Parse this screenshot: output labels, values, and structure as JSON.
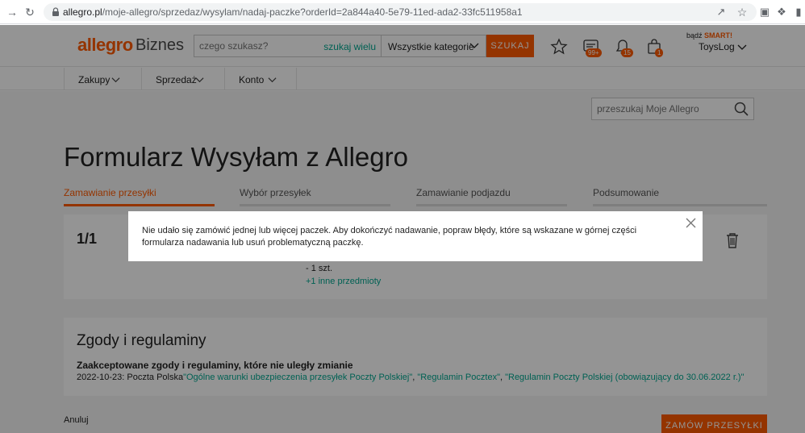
{
  "browser": {
    "url_host": "allegro.pl",
    "url_path": "/moje-allegro/sprzedaz/wysylam/nadaj-paczke?orderId=2a844a40-5e79-11ed-ada2-33fc511958a1"
  },
  "header": {
    "logo": "allegro",
    "logo_sub": "Biznes",
    "search_placeholder": "czego szukasz?",
    "search_many": "szukaj wielu",
    "category": "Wszystkie kategorie",
    "search_button": "SZUKAJ",
    "messages_badge": "99+",
    "notifications_badge": "15",
    "cart_badge": "1",
    "smart_prefix": "bądź",
    "smart_label": "SMART!",
    "user": "ToysLog"
  },
  "nav": {
    "items": [
      {
        "label": "Zakupy"
      },
      {
        "label": "Sprzedaż"
      },
      {
        "label": "Konto"
      }
    ]
  },
  "main": {
    "my_search_placeholder": "przeszukaj Moje Allegro",
    "title": "Formularz Wysyłam z Allegro",
    "steps": [
      {
        "label": "Zamawianie przesyłki",
        "active": true
      },
      {
        "label": "Wybór przesyłek",
        "active": false
      },
      {
        "label": "Zamawianie podjazdu",
        "active": false
      },
      {
        "label": "Podsumowanie",
        "active": false
      }
    ],
    "package": {
      "number": "1/1",
      "quantity": "- 1 szt.",
      "more_items": "+1 inne przedmioty"
    },
    "consents": {
      "title": "Zgody i regulaminy",
      "subtitle": "Zaakceptowane zgody i regulaminy, które nie uległy zmianie",
      "date_prefix": "2022-10-23: Poczta Polska",
      "link1": "\"Ogólne warunki ubezpieczenia przesyłek Poczty Polskiej\"",
      "sep1": ", ",
      "link2": "\"Regulamin Pocztex\"",
      "sep2": ", ",
      "link3": "\"Regulamin Poczty Polskiej (obowiązujący do 30.06.2022 r.)\""
    },
    "cancel": "Anuluj",
    "order_button": "ZAMÓW PRZESYŁKI"
  },
  "modal": {
    "message": "Nie udało się zamówić jednej lub więcej paczek. Aby dokończyć nadawanie, popraw błędy, które są wskazane w górnej części formularza nadawania lub usuń problematyczną paczkę."
  },
  "colors": {
    "accent": "#ff5a00",
    "link": "#00a790"
  }
}
